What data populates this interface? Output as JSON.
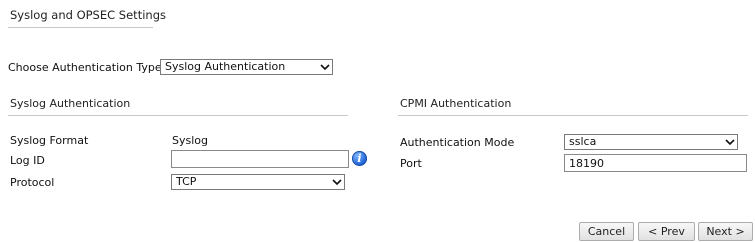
{
  "page": {
    "title": "Syslog and OPSEC Settings"
  },
  "auth_type": {
    "label": "Choose Authentication Type",
    "value": "Syslog Authentication"
  },
  "syslog": {
    "heading": "Syslog Authentication",
    "format_label": "Syslog Format",
    "format_value": "Syslog",
    "log_id_label": "Log ID",
    "log_id_value": "",
    "protocol_label": "Protocol",
    "protocol_value": "TCP",
    "info_icon": "info-icon"
  },
  "cpmi": {
    "heading": "CPMI Authentication",
    "mode_label": "Authentication Mode",
    "mode_value": "sslca",
    "port_label": "Port",
    "port_value": "18190"
  },
  "buttons": {
    "cancel": "Cancel",
    "prev": "< Prev",
    "next": "Next >"
  },
  "colors": {
    "rule": "#c8c8c8",
    "info_blue": "#1a5fd1"
  }
}
